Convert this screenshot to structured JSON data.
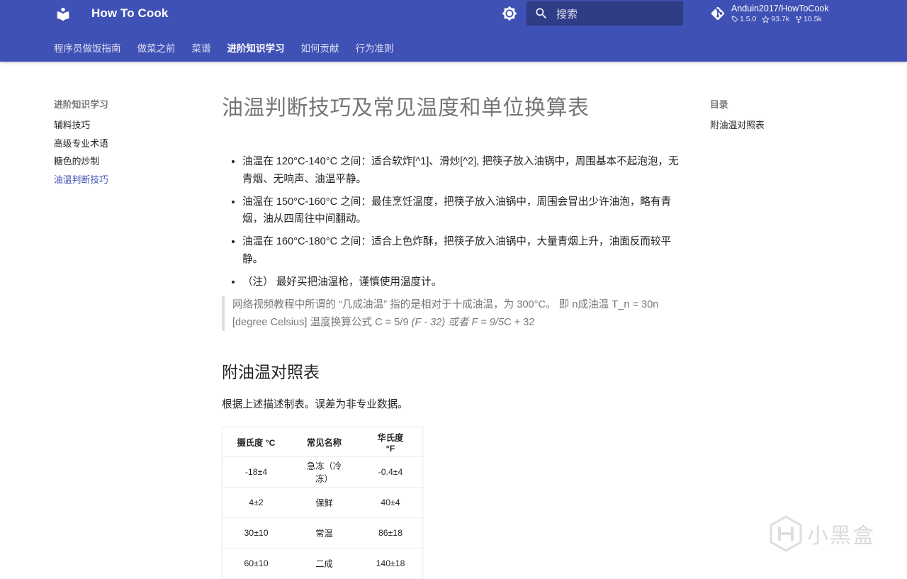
{
  "header": {
    "title": "How To Cook",
    "search_placeholder": "搜索",
    "repo": {
      "name": "Anduin2017/HowToCook",
      "version": "1.5.0",
      "stars": "93.7k",
      "forks": "10.5k"
    },
    "tabs": [
      {
        "label": "程序员做饭指南",
        "active": false
      },
      {
        "label": "做菜之前",
        "active": false
      },
      {
        "label": "菜谱",
        "active": false
      },
      {
        "label": "进阶知识学习",
        "active": true
      },
      {
        "label": "如何贡献",
        "active": false
      },
      {
        "label": "行为准则",
        "active": false
      }
    ]
  },
  "sidebar": {
    "title": "进阶知识学习",
    "items": [
      {
        "label": "辅料技巧"
      },
      {
        "label": "高级专业术语"
      },
      {
        "label": "糖色的炒制"
      },
      {
        "label": "油温判断技巧",
        "active": true
      }
    ]
  },
  "toc": {
    "title": "目录",
    "items": [
      "附油温对照表"
    ]
  },
  "article": {
    "title": "油温判断技巧及常见温度和单位换算表",
    "bullets": [
      "油温在 120°C-140°C 之间：适合软炸[^1]、滑炒[^2], 把筷子放入油锅中，周围基本不起泡泡，无青烟、无响声、油温平静。",
      "油温在 150°C-160°C 之间：最佳烹饪温度，把筷子放入油锅中，周围会冒出少许油泡，略有青烟，油从四周往中间翻动。",
      "油温在 160°C-180°C 之间：适合上色炸酥，把筷子放入油锅中，大量青烟上升，油面反而较平静。",
      "（注） 最好买把油温枪，谨慎使用温度计。"
    ],
    "note": {
      "part1": "网络视频教程中所谓的 “几成油温” 指的是相对于十成油温，为 300°C。 即 n成油温 T_n = 30n [degree Celsius] 温度换算公式 C = 5/9 ",
      "em": "(F - 32) 或者 F = 9/5",
      "part2": "C + 32"
    },
    "section_title": "附油温对照表",
    "section_intro": "根据上述描述制表。误差为非专业数据。",
    "table": {
      "headers": [
        "摄氏度 °C",
        "常见名称",
        "华氏度 °F"
      ],
      "rows": [
        [
          "-18±4",
          "急冻（冷冻）",
          "-0.4±4"
        ],
        [
          "4±2",
          "保鲜",
          "40±4"
        ],
        [
          "30±10",
          "常温",
          "86±18"
        ],
        [
          "60±10",
          "二成",
          "140±18"
        ]
      ]
    }
  },
  "watermark": {
    "text": "小黑盒"
  },
  "colors": {
    "primary": "#4051b5",
    "active_link": "#4051b5"
  }
}
